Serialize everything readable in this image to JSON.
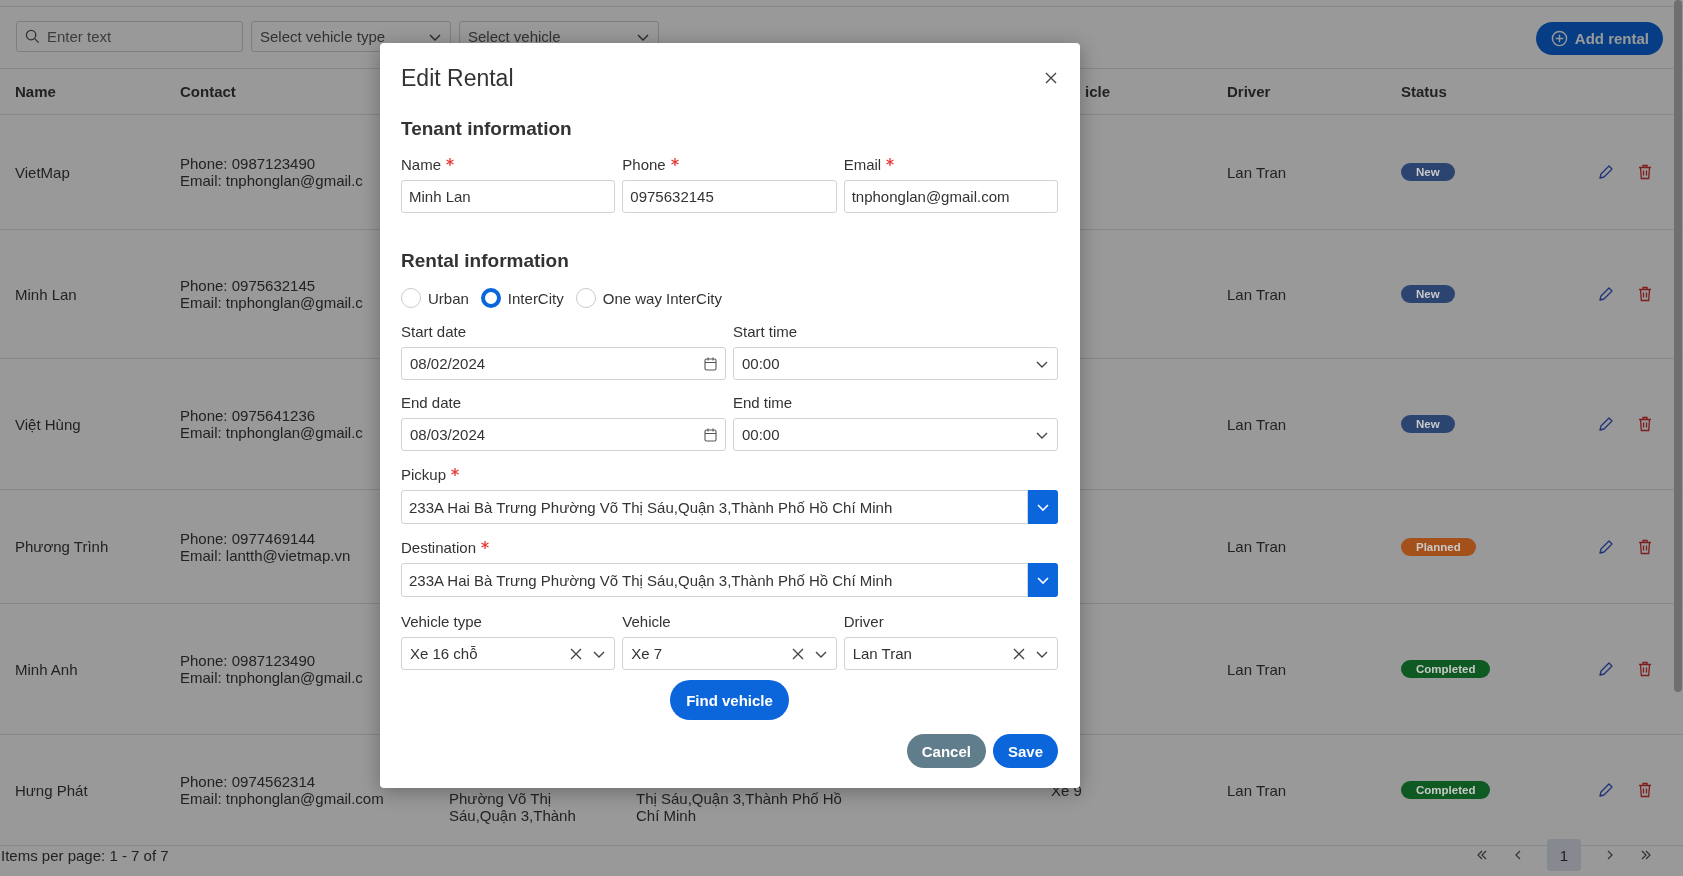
{
  "filters": {
    "search": {
      "placeholder": "Enter text"
    },
    "vehicle_type": {
      "placeholder": "Select vehicle type"
    },
    "vehicle": {
      "placeholder": "Select vehicle"
    }
  },
  "add_button": {
    "label": "Add rental"
  },
  "table": {
    "columns": [
      "Name",
      "Contact",
      "icle",
      "Driver",
      "Status"
    ],
    "rows": [
      {
        "name": "VietMap",
        "phone": "Phone: 0987123490",
        "email": "Email: tnphonglan@gmail.c",
        "driver": "Lan Tran",
        "status": {
          "label": "New",
          "color": "#2c4470"
        }
      },
      {
        "name": "Minh Lan",
        "phone": "Phone: 0975632145",
        "email": "Email: tnphonglan@gmail.c",
        "driver": "Lan Tran",
        "status": {
          "label": "New",
          "color": "#2c4470"
        }
      },
      {
        "name": "Việt Hùng",
        "phone": "Phone: 0975641236",
        "email": "Email: tnphonglan@gmail.c",
        "driver": "Lan Tran",
        "status": {
          "label": "New",
          "color": "#2c4470"
        }
      },
      {
        "name": "Phương Trình",
        "phone": "Phone: 0977469144",
        "email": "Email: lantth@vietmap.vn",
        "driver": "Lan Tran",
        "status": {
          "label": "Planned",
          "color": "#a4501a"
        }
      },
      {
        "name": "Minh Anh",
        "phone": "Phone: 0987123490",
        "email": "Email: tnphonglan@gmail.c",
        "driver": "Lan Tran",
        "status": {
          "label": "Completed",
          "color": "#0f5a22"
        }
      },
      {
        "name": "Hưng Phát",
        "phone": "Phone: 0974562314",
        "email": "Email: tnphonglan@gmail.com",
        "pickup_lines": [
          "Phường Võ Thị",
          "Sáu,Quận 3,Thành"
        ],
        "destination_lines": [
          "Thị Sáu,Quận 3,Thành Phố Hồ",
          "Chí Minh"
        ],
        "vehicle": "Xe 9",
        "driver": "Lan Tran",
        "status": {
          "label": "Completed",
          "color": "#0f5a22"
        }
      }
    ]
  },
  "pagination": {
    "summary": "Items per page: 1 - 7 of 7",
    "pages": [
      {
        "label": "1",
        "selected": true
      }
    ]
  },
  "modal": {
    "title": "Edit Rental",
    "tenant": {
      "heading": "Tenant information",
      "fields": [
        {
          "label": "Name",
          "required": true,
          "value": "Minh Lan"
        },
        {
          "label": "Phone",
          "required": true,
          "value": "0975632145"
        },
        {
          "label": "Email",
          "required": true,
          "value": "tnphonglan@gmail.com"
        }
      ]
    },
    "rental": {
      "heading": "Rental information",
      "trip_types": [
        {
          "label": "Urban",
          "selected": false
        },
        {
          "label": "InterCity",
          "selected": true
        },
        {
          "label": "One way InterCity",
          "selected": false
        }
      ],
      "schedule": [
        {
          "label": "Start date",
          "kind": "date",
          "value": "08/02/2024"
        },
        {
          "label": "Start time",
          "kind": "time",
          "value": "00:00"
        },
        {
          "label": "End date",
          "kind": "date",
          "value": "08/03/2024"
        },
        {
          "label": "End time",
          "kind": "time",
          "value": "00:00"
        }
      ],
      "locations": [
        {
          "label": "Pickup",
          "required": true,
          "value": "233A Hai Bà Trưng Phường Võ Thị Sáu,Quận 3,Thành Phố Hồ Chí Minh"
        },
        {
          "label": "Destination",
          "required": true,
          "value": "233A Hai Bà Trưng Phường Võ Thị Sáu,Quận 3,Thành Phố Hồ Chí Minh"
        }
      ],
      "assignment": [
        {
          "label": "Vehicle type",
          "value": "Xe 16 chỗ"
        },
        {
          "label": "Vehicle",
          "value": "Xe 7"
        },
        {
          "label": "Driver",
          "value": "Lan Tran"
        }
      ],
      "find_button": "Find vehicle"
    },
    "buttons": [
      {
        "label": "Cancel",
        "kind": "secondary"
      },
      {
        "label": "Save",
        "kind": "primary"
      }
    ]
  }
}
